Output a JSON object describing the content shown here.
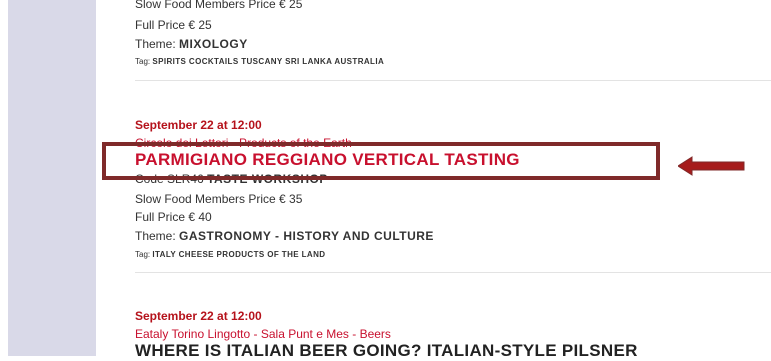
{
  "event1": {
    "members_price": "Slow Food Members Price € 25",
    "full_price": "Full Price € 25",
    "theme_label": "Theme:",
    "theme_value": "MIXOLOGY",
    "tag_label": "Tag:",
    "tag_value": "SPIRITS COCKTAILS TUSCANY SRI LANKA AUSTRALIA"
  },
  "event2": {
    "date": "September 22 at 12:00",
    "location": "Circolo dei Lettori - Products of the Earth",
    "title": "PARMIGIANO REGGIANO VERTICAL TASTING",
    "code_label": "Code SLR46",
    "type": "TASTE WORKSHOP",
    "members_price": "Slow Food Members Price € 35",
    "full_price": "Full Price € 40",
    "theme_label": "Theme:",
    "theme_value": "GASTRONOMY - HISTORY AND CULTURE",
    "tag_label": "Tag:",
    "tag_value": "ITALY CHEESE PRODUCTS OF THE LAND"
  },
  "event3": {
    "date": "September 22 at 12:00",
    "location": "Eataly Torino Lingotto - Sala Punt e Mes - Beers",
    "title": "WHERE IS ITALIAN BEER GOING? ITALIAN-STYLE PILSNER"
  },
  "colors": {
    "accent_red": "#c8102e",
    "highlight_border": "#7f2a2a",
    "sidebar": "#d9d9e8"
  }
}
